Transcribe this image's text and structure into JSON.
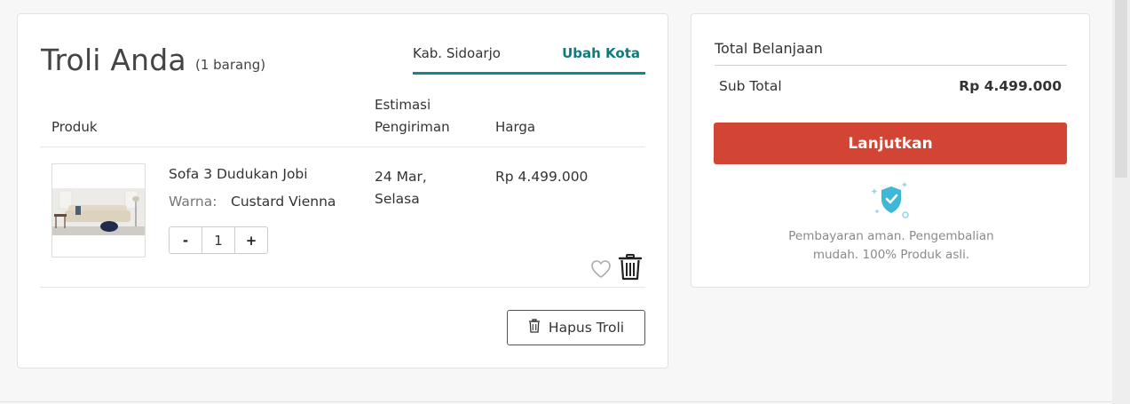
{
  "cart": {
    "title": "Troli Anda",
    "count_label": "(1 barang)",
    "city": "Kab. Sidoarjo",
    "change_city": "Ubah Kota",
    "columns": {
      "product": "Produk",
      "shipping_estimate": "Estimasi Pengiriman",
      "price": "Harga"
    },
    "items": [
      {
        "name": "Sofa 3 Dudukan Jobi",
        "color_label": "Warna:",
        "color_value": "Custard Vienna",
        "quantity": "1",
        "decrement": "-",
        "increment": "+",
        "shipping_date": "24 Mar, Selasa",
        "price": "Rp 4.499.000"
      }
    ],
    "clear_button": "Hapus Troli"
  },
  "summary": {
    "title": "Total Belanjaan",
    "subtotal_label": "Sub Total",
    "subtotal_value": "Rp 4.499.000",
    "continue_button": "Lanjutkan",
    "secure_text": "Pembayaran aman. Pengembalian mudah. 100% Produk asli."
  },
  "colors": {
    "accent_teal": "#0f8a8a",
    "primary_button": "#d24433",
    "shield": "#3fb8d8"
  },
  "icons": {
    "wishlist": "heart-icon",
    "delete": "trash-icon",
    "clear": "trash-icon",
    "security": "shield-check-icon"
  }
}
